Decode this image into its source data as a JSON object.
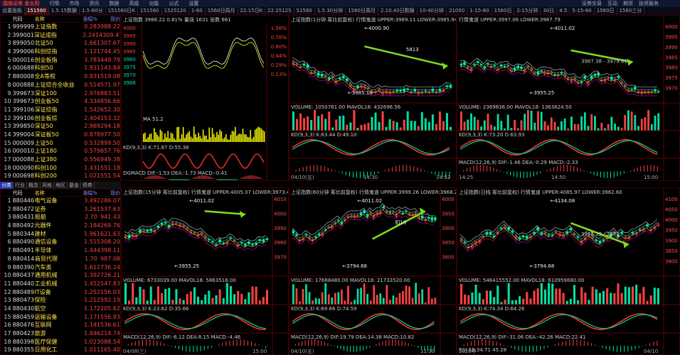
{
  "topbar": {
    "logo": "国信证券 金太阳",
    "items": [
      "行情",
      "市场",
      "资讯",
      "数据",
      "高级",
      "功能",
      "公式",
      "设置"
    ],
    "right": [
      "证券交易",
      "互动",
      "期货",
      "投资服务"
    ]
  },
  "tabs": [
    "设置面板",
    "151560",
    "1.5.15数据",
    "1.5-60分",
    "151560日K",
    "151560",
    "1525120",
    "1-60",
    "1560日周月",
    "22.15日K",
    "22.25125",
    "51560",
    "1.5.30分钟",
    "1560日周月",
    "2.10.40日数据",
    "10-40分钟",
    "21050",
    "1-15-60",
    "1560日",
    "2-15分钟",
    "30日",
    "4.5",
    "5-15-60",
    "1560日",
    "1560三分"
  ],
  "list1": {
    "headers": [
      "",
      "代码",
      "名称",
      "涨幅%",
      "现价"
    ],
    "rows": [
      [
        "1",
        "999999",
        "上证指数",
        "0.28",
        "3988.22"
      ],
      [
        "2",
        "399001",
        "深证成指",
        "2.24",
        "14309.47"
      ],
      [
        "3",
        "899050",
        "北证50",
        "1.66",
        "1307.67"
      ],
      [
        "4",
        "399006",
        "科创综指",
        "1.12",
        "1744.45"
      ],
      [
        "5",
        "000016",
        "创业板指",
        "3.78",
        "3449.79"
      ],
      [
        "6",
        "000688",
        "科创50",
        "1.93",
        "1143.84"
      ],
      [
        "7",
        "880008",
        "全A等权",
        "0.93",
        "1519.08"
      ],
      [
        "8",
        "000888",
        "上证综合全收益",
        "0.51",
        "4571.97"
      ],
      [
        "9",
        "399673",
        "深证100",
        "2.97",
        "6883.51"
      ],
      [
        "10",
        "399673",
        "创业板50",
        "4.33",
        "4856.66"
      ],
      [
        "11",
        "399106",
        "深证综指",
        "1.54",
        "2652.30"
      ],
      [
        "12",
        "399106",
        "创业板综",
        "2.40",
        "4153.32"
      ],
      [
        "13",
        "399850",
        "深证50",
        "2.96",
        "9294.18"
      ],
      [
        "14",
        "399004",
        "深证板50",
        "0.87",
        "8977.50"
      ],
      [
        "15",
        "000009",
        "上证50",
        "0.53",
        "2899.50"
      ],
      [
        "16",
        "000010",
        "上证180",
        "0.57",
        "9857.76"
      ],
      [
        "17",
        "000088",
        "上证380",
        "0.55",
        "6949.38"
      ],
      [
        "18",
        "000090",
        "科创100",
        "1.43",
        "1551.18"
      ],
      [
        "19",
        "000698",
        "科创200",
        "1.02",
        "1551.54"
      ],
      [
        "20",
        "399303",
        "中证A100",
        "1.62",
        "4524.48"
      ]
    ]
  },
  "mtabs": [
    "分类",
    "行业",
    "概念",
    "风格",
    "地区",
    "基金",
    "债券"
  ],
  "list2": {
    "headers": [
      "",
      "代码",
      "名称",
      "涨幅%",
      "现价"
    ],
    "rows": [
      [
        "1",
        "880446",
        "电气设备",
        "3.49",
        "2286.07"
      ],
      [
        "2",
        "880472",
        "证券",
        "3.26",
        "1537.63"
      ],
      [
        "3",
        "880431",
        "船舶",
        "2.70",
        "941.43"
      ],
      [
        "4",
        "880492",
        "元器件",
        "2.18",
        "4269.76"
      ],
      [
        "5",
        "880344",
        "建材",
        "1.96",
        "1621.63"
      ],
      [
        "6",
        "880490",
        "通信设备",
        "1.51",
        "5308.20"
      ],
      [
        "7",
        "880491",
        "半导体",
        "1.44",
        "4398.11"
      ],
      [
        "8",
        "880414",
        "商贸代理",
        "1.70",
        "987.08"
      ],
      [
        "9",
        "880390",
        "汽车类",
        "1.61",
        "2736.24"
      ],
      [
        "10",
        "880437",
        "通用机械",
        "1.39",
        "2726.21"
      ],
      [
        "11",
        "880440",
        "工业机械",
        "1.45",
        "2547.83"
      ],
      [
        "12",
        "880489",
        "IT设备",
        "1.25",
        "2156.03"
      ],
      [
        "13",
        "880473",
        "保险",
        "1.21",
        "2592.19"
      ],
      [
        "14",
        "880430",
        "航空",
        "1.17",
        "2205.62"
      ],
      [
        "15",
        "880459",
        "运输设备",
        "1.17",
        "1556.93"
      ],
      [
        "16",
        "880476",
        "互联网",
        "1.14",
        "1536.61"
      ],
      [
        "17",
        "880423",
        "旅游",
        "1.84",
        "6214.74"
      ],
      [
        "18",
        "880398",
        "医疗保健",
        "1.02",
        "3088.54"
      ],
      [
        "19",
        "880355",
        "日用化工",
        "1.01",
        "1165.40"
      ]
    ]
  },
  "panels": {
    "p1": {
      "title": "上证指数 3988.22 0.81% 量涨 1631 张数 661",
      "prices": [
        "4000",
        "3995",
        "3990",
        "3985",
        "3980",
        "3975",
        "3970",
        "3966"
      ],
      "pct": [
        "1.56%",
        "0.76%",
        "0.60%",
        "0.44%",
        "0.29%",
        "0.13%"
      ],
      "mid_label": "MA 51.2",
      "kd": "KD(9,3,3) K:71.87 D:55.38",
      "macd": "DGMACD DIF:-1.53 DEA:-1.73 MACD:-0.41"
    },
    "p2": {
      "title": "上证指数(1分钟 筹比前复权) 行情鬼道 UPPER:3989.11 LOWER:3985.94",
      "high": "4000.90",
      "low": "3985.10",
      "mark": "5813",
      "vol": "VOLUME: 1050761.00 MAVOL18: 432696.56",
      "kd": "KD(9,3,3) K:63.44 D:49.10",
      "times": [
        "04/10(五)",
        "14:30",
        "14:52"
      ]
    },
    "p3": {
      "title": "行情鬼道 UPPER:3997.06 LOWER:3987.79",
      "high": "4011.02",
      "low": "3955.25",
      "mid": "3987.38 - 3979.81",
      "axis": [
        "4000",
        "3995",
        "3990",
        "3985",
        "3980",
        "3975",
        "3970"
      ],
      "vol": "VOLUME: 2369836.00 MAVOL18: 1363624.50",
      "kd": "KD(9,3,3) K:73.20 D:63.93",
      "macd": "MACD(12,26,9) DIF:-1.46 DEA:-0.29 MACD:-2.33",
      "times": [
        "14:25",
        "14:50",
        "15:00"
      ]
    },
    "p4": {
      "title": "上证指数(15分钟 筹比前复权) 行情鬼道 UPPER:4005.07 LOWER:3973.4",
      "high": "4011.02",
      "low": "3955.25",
      "axis": [
        "4010",
        "4000",
        "3990",
        "3980",
        "3970"
      ],
      "vol": "VOLUME: 6733039.00 MAVOL18: 5863518.00",
      "kd": "KD(9,3,3) K:23.62 D:35.66",
      "macd": "MACD(12,26,9) DIF:-6.12 DEA:8.15 MACD:-4.46",
      "times": [
        "04/08(三)",
        "15:00"
      ]
    },
    "p5": {
      "title": "上证指数(60分钟 筹比前复权) 行情鬼道 UPPER:3999.26 LOWER:3968.2",
      "high": "4011.02",
      "low": "3794.68",
      "mark": "扣18",
      "axis": [
        "4000",
        "3950",
        "3900",
        "3850",
        "3800"
      ],
      "vol": "VOLUME: 17688480.00 MAVOL18: 21733520.00",
      "kd": "KD(9,3,3) K:69.66 D:74.59",
      "macd": "MACD(12,26,9) DIF:19.79 DEA:14.38 MACD:10.82",
      "times": [
        "04/10(五)",
        "11:30"
      ]
    },
    "p6": {
      "title": "上证指数(日线 筹比前复权) 行情鬼道 UPPER:4085.97 LOWER:3962.60",
      "high": "4134.08",
      "low": "3794.68",
      "mid": "3978.13 - 3975",
      "axis": [
        "4100",
        "4050",
        "4000",
        "3950",
        "3900",
        "3850",
        "3800"
      ],
      "vol": "VOLUME: 546415552.00 MAVOL18: 610959680.00",
      "kd": "KD(9,3,3) K:74.34 D:64.26",
      "macd": "MACD(12,26,9) DIF:-31.06 DEA:-42.26 MACD:22.41",
      "rsi": "RSI  58:34.71 45.28",
      "times": [
        "2026年",
        "04/10"
      ]
    }
  },
  "colors": {
    "up": "#ff4040",
    "down": "#00e0a0",
    "arrow": "#80dd20",
    "ma": "#ff00ff",
    "mid": "#ffff00"
  }
}
